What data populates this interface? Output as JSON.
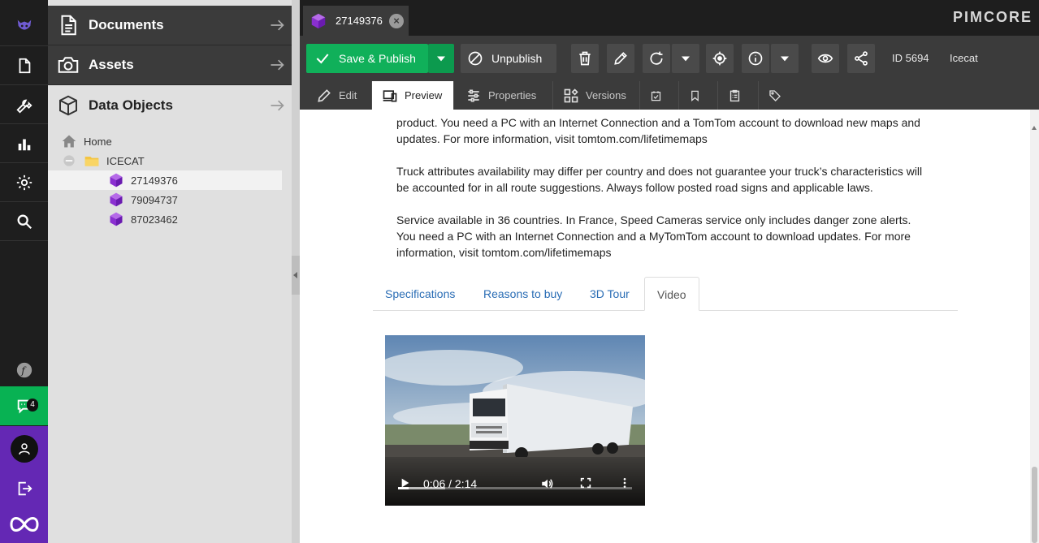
{
  "sidebar_rail": {
    "notification_count": "4"
  },
  "tree_panel": {
    "sections": [
      {
        "label": "Documents"
      },
      {
        "label": "Assets"
      },
      {
        "label": "Data Objects"
      }
    ],
    "tree": [
      {
        "label": "Home"
      },
      {
        "label": "ICECAT"
      },
      {
        "label": "27149376"
      },
      {
        "label": "79094737"
      },
      {
        "label": "87023462"
      }
    ]
  },
  "topbar": {
    "open_tab": "27149376",
    "brand": "PIMCORE"
  },
  "toolbar": {
    "save_publish": "Save & Publish",
    "unpublish": "Unpublish",
    "id_label": "ID 5694",
    "class_label": "Icecat"
  },
  "editor_tabs": {
    "edit": "Edit",
    "preview": "Preview",
    "properties": "Properties",
    "versions": "Versions"
  },
  "content": {
    "paragraphs": [
      "product. You need a PC with an Internet Connection and a TomTom account to download new maps and updates. For more information, visit tomtom.com/lifetimemaps",
      "Truck attributes availability may differ per country and does not guarantee your truck’s characteristics will be accounted for in all route suggestions. Always follow posted road signs and applicable laws.",
      "Service available in 36 countries. In France, Speed Cameras service only includes danger zone alerts. You need a PC with an Internet Connection and a MyTomTom account to download updates. For more information, visit tomtom.com/lifetimemaps"
    ],
    "tabs": [
      "Specifications",
      "Reasons to buy",
      "3D Tour",
      "Video"
    ],
    "active_tab": "Video",
    "video": {
      "time": "0:06 / 2:14",
      "progress": 0.045,
      "buffered": 0.2
    }
  },
  "colors": {
    "accent_green": "#10b05a",
    "accent_purple": "#6428b4",
    "link_blue": "#2a6db5"
  }
}
